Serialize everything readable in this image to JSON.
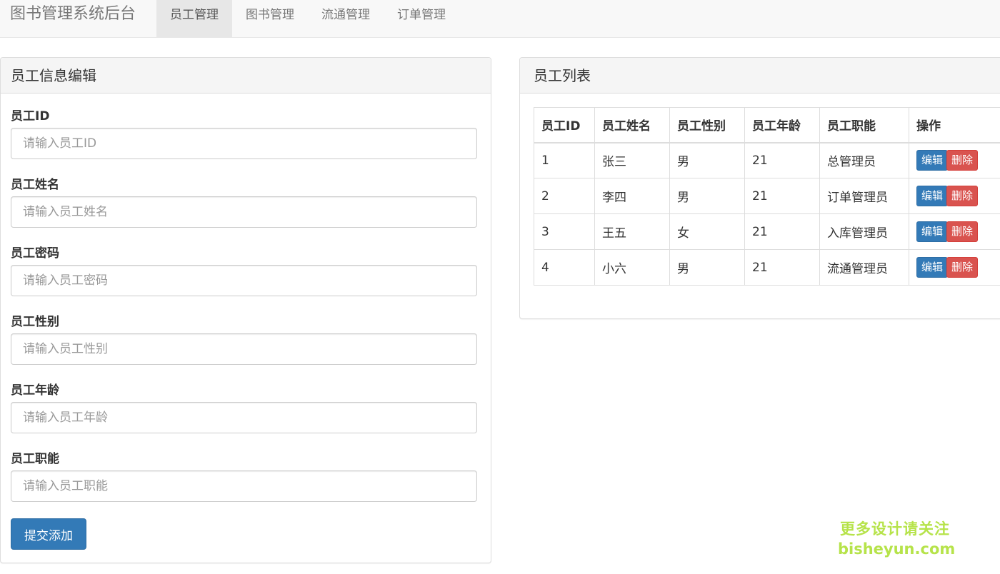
{
  "app": {
    "title": "图书管理系统后台"
  },
  "nav": {
    "items": [
      {
        "label": "员工管理",
        "active": true
      },
      {
        "label": "图书管理",
        "active": false
      },
      {
        "label": "流通管理",
        "active": false
      },
      {
        "label": "订单管理",
        "active": false
      }
    ]
  },
  "form_panel": {
    "title": "员工信息编辑",
    "fields": [
      {
        "label": "员工ID",
        "placeholder": "请输入员工ID",
        "value": ""
      },
      {
        "label": "员工姓名",
        "placeholder": "请输入员工姓名",
        "value": ""
      },
      {
        "label": "员工密码",
        "placeholder": "请输入员工密码",
        "value": ""
      },
      {
        "label": "员工性别",
        "placeholder": "请输入员工性别",
        "value": ""
      },
      {
        "label": "员工年龄",
        "placeholder": "请输入员工年龄",
        "value": ""
      },
      {
        "label": "员工职能",
        "placeholder": "请输入员工职能",
        "value": ""
      }
    ],
    "submit_label": "提交添加"
  },
  "list_panel": {
    "title": "员工列表",
    "columns": [
      "员工ID",
      "员工姓名",
      "员工性别",
      "员工年龄",
      "员工职能",
      "操作"
    ],
    "rows": [
      {
        "id": "1",
        "name": "张三",
        "gender": "男",
        "age": "21",
        "role": "总管理员"
      },
      {
        "id": "2",
        "name": "李四",
        "gender": "男",
        "age": "21",
        "role": "订单管理员"
      },
      {
        "id": "3",
        "name": "王五",
        "gender": "女",
        "age": "21",
        "role": "入库管理员"
      },
      {
        "id": "4",
        "name": "小六",
        "gender": "男",
        "age": "21",
        "role": "流通管理员"
      }
    ],
    "edit_label": "编辑",
    "delete_label": "删除"
  },
  "watermark": {
    "line1": "更多设计请关注",
    "line2": "bisheyun.com"
  },
  "colors": {
    "primary": "#337ab7",
    "danger": "#d9534f",
    "navbar_bg": "#f8f8f8",
    "panel_heading_bg": "#f5f5f5",
    "watermark": "#b6e34a"
  }
}
